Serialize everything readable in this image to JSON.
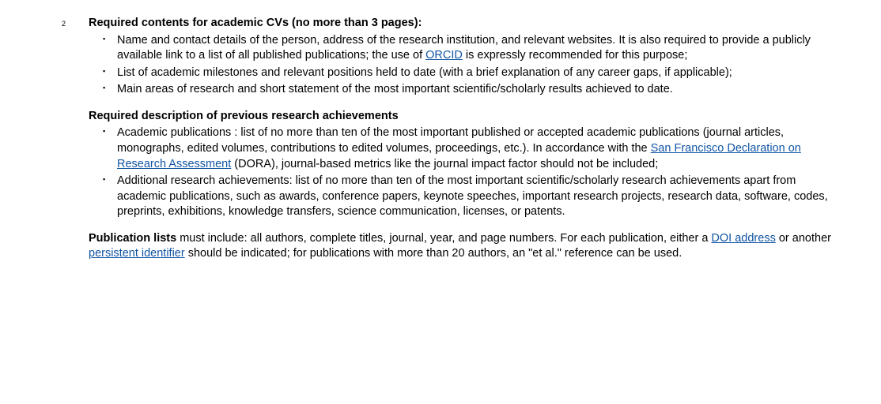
{
  "footnote": "2",
  "section1": {
    "heading": "Required contents for academic CVs (no more than 3 pages):",
    "item1a": "Name and contact details of the person, address of the research institution, and relevant websites. It is also required to provide a publicly available link to a list of all published publications; the use of ",
    "link1": "ORCID",
    "item1b": " is expressly recommended for this purpose;",
    "item2": "List of academic milestones and relevant positions held to date (with a brief explanation of any career gaps, if applicable);",
    "item3": "Main areas of research and short statement of the most important scientific/scholarly results achieved to date."
  },
  "section2": {
    "heading": "Required description of previous research achievements",
    "item1a": "Academic publications : list of no more than ten of the most important published or accepted academic publications (journal articles, monographs, edited volumes, contributions to edited volumes, proceedings, etc.). In accordance with the ",
    "link1": "San Francisco Declaration on Research Assessment",
    "item1b": " (DORA), journal-based metrics like the journal impact factor should not be included;",
    "item2": "Additional research achievements: list of no more than ten of the most important scientific/scholarly research achievements apart from academic publications, such as awards, conference papers, keynote speeches, important research projects, research data, software, codes, preprints, exhibitions, knowledge transfers, science communication, licenses, or patents."
  },
  "section3": {
    "bold": "Publication lists",
    "text1": " must include: all authors, complete titles, journal, year, and page numbers. For each publication, either a ",
    "link1": "DOI address",
    "text2": " or another ",
    "link2": "persistent identifier",
    "text3": " should be indicated; for publications with more than 20 authors, an \"et al.\" reference can be used."
  }
}
